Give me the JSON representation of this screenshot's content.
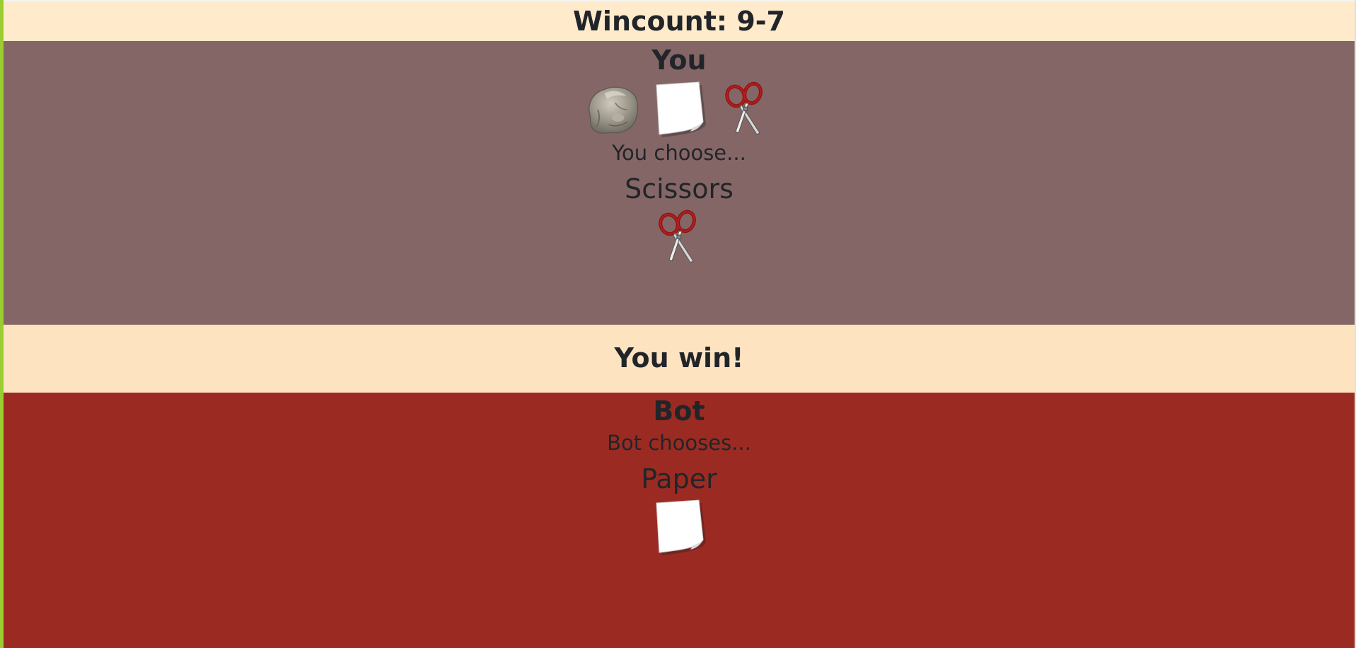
{
  "scoreboard": {
    "wincount_text": "Wincount: 9-7"
  },
  "player": {
    "title": "You",
    "choices": [
      {
        "label": "Rock",
        "icon": "rock-icon"
      },
      {
        "label": "Paper",
        "icon": "paper-icon"
      },
      {
        "label": "Scissors",
        "icon": "scissors-icon"
      }
    ],
    "prompt": "You choose...",
    "selected_choice": "Scissors",
    "selected_icon": "scissors-icon"
  },
  "result": {
    "text": "You win!"
  },
  "bot": {
    "title": "Bot",
    "prompt": "Bot chooses...",
    "selected_choice": "Paper",
    "selected_icon": "paper-icon"
  },
  "colors": {
    "wincount_bg": "#ffeacb",
    "player_bg": "#856666",
    "result_bg": "#fee3c1",
    "bot_bg": "#9b2b22",
    "border_accent": "#9acd32",
    "text": "#212529"
  }
}
